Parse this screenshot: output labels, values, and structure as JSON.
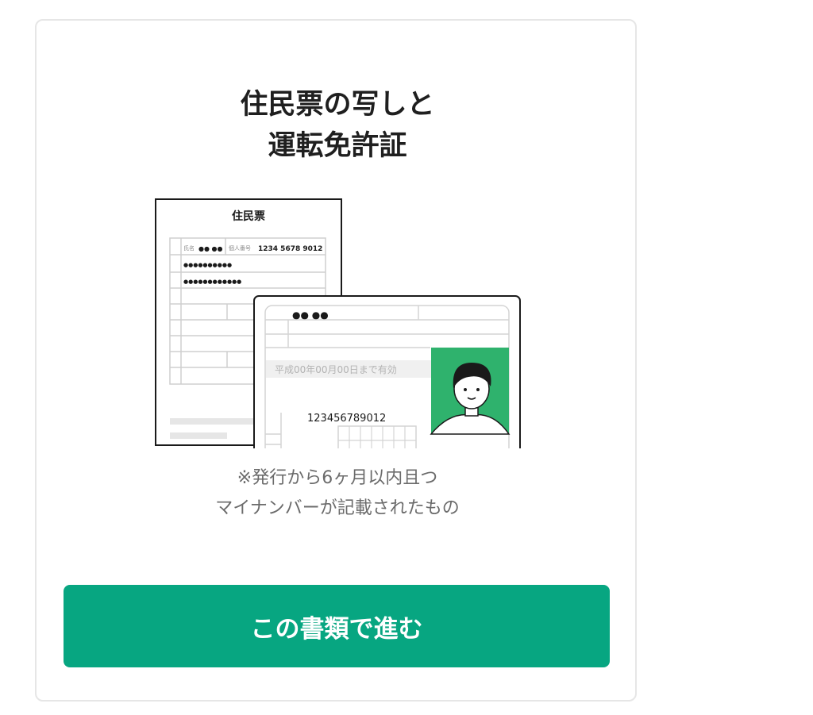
{
  "card": {
    "title_line1": "住民票の写しと",
    "title_line2": "運転免許証",
    "note_line1": "※発行から6ヶ月以内且つ",
    "note_line2": "マイナンバーが記載されたもの",
    "button_label": "この書類で進む"
  },
  "illustration": {
    "resident_doc": {
      "heading": "住民票",
      "name_label": "氏名",
      "name_value": "●● ●●",
      "number_label": "個人番号",
      "number_value": "1234 5678 9012",
      "dots_row1": "●●●●●●●●●●",
      "dots_row2": "●●●●●●●●●●●●"
    },
    "license_card": {
      "name_dots": "●● ●●",
      "validity_text": "平成00年00月00日まで有効",
      "number": "123456789012"
    },
    "photo_bg_color": "#2fb26d"
  },
  "colors": {
    "accent": "#07a681",
    "border": "#e6e6e6",
    "title_text": "#1f1f1f",
    "note_text": "#6b6b6b"
  }
}
